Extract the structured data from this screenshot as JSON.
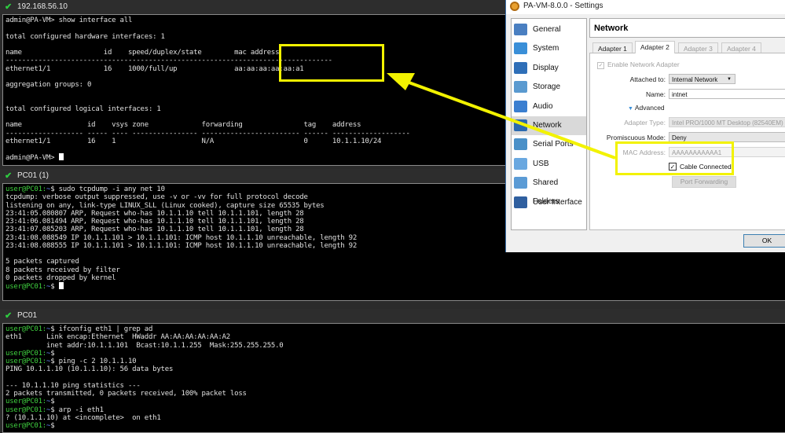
{
  "term1": {
    "tab_title": "192.168.56.10",
    "lines": [
      "admin@PA-VM> show interface all",
      "",
      "total configured hardware interfaces: 1",
      "",
      "name                    id    speed/duplex/state        mac address",
      "--------------------------------------------------------------------------------",
      "ethernet1/1             16    1000/full/up              aa:aa:aa:aa:aa:a1",
      "",
      "aggregation groups: 0",
      "",
      "",
      "total configured logical interfaces: 1",
      "",
      "name                id    vsys zone             forwarding               tag    address",
      "------------------- ----- ---- ---------------- ------------------------ ------ -------------------",
      "ethernet1/1         16    1                     N/A                      0      10.1.1.10/24",
      "",
      "admin@PA-VM> "
    ]
  },
  "term2": {
    "tab_title": "PC01 (1)",
    "prompt_user": "user@PC01:",
    "prompt_tail": "~",
    "prompt_sign": "$ ",
    "lines": [
      {
        "p": true,
        "t": "sudo tcpdump -i any net 10"
      },
      {
        "t": "tcpdump: verbose output suppressed, use -v or -vv for full protocol decode"
      },
      {
        "t": "listening on any, link-type LINUX_SLL (Linux cooked), capture size 65535 bytes"
      },
      {
        "t": "23:41:05.080807 ARP, Request who-has 10.1.1.10 tell 10.1.1.101, length 28"
      },
      {
        "t": "23:41:06.081494 ARP, Request who-has 10.1.1.10 tell 10.1.1.101, length 28"
      },
      {
        "t": "23:41:07.085203 ARP, Request who-has 10.1.1.10 tell 10.1.1.101, length 28"
      },
      {
        "t": "23:41:08.088549 IP 10.1.1.101 > 10.1.1.101: ICMP host 10.1.1.10 unreachable, length 92"
      },
      {
        "t": "23:41:08.088555 IP 10.1.1.101 > 10.1.1.101: ICMP host 10.1.1.10 unreachable, length 92"
      },
      {
        "t": ""
      },
      {
        "t": "5 packets captured"
      },
      {
        "t": "8 packets received by filter"
      },
      {
        "t": "0 packets dropped by kernel"
      },
      {
        "p": true,
        "t": "",
        "cursor": true
      }
    ]
  },
  "term3": {
    "tab_title": "PC01",
    "lines": [
      {
        "p": true,
        "t": "ifconfig eth1 | grep ad"
      },
      {
        "t": "eth1      Link encap:Ethernet  HWaddr AA:AA:AA:AA:AA:A2"
      },
      {
        "t": "          inet addr:10.1.1.101  Bcast:10.1.1.255  Mask:255.255.255.0"
      },
      {
        "p": true,
        "t": ""
      },
      {
        "p": true,
        "t": "ping -c 2 10.1.1.10"
      },
      {
        "t": "PING 10.1.1.10 (10.1.1.10): 56 data bytes"
      },
      {
        "t": ""
      },
      {
        "t": "--- 10.1.1.10 ping statistics ---"
      },
      {
        "t": "2 packets transmitted, 0 packets received, 100% packet loss"
      },
      {
        "p": true,
        "t": ""
      },
      {
        "p": true,
        "t": "arp -i eth1"
      },
      {
        "t": "? (10.1.1.10) at <incomplete>  on eth1"
      },
      {
        "p": true,
        "t": ""
      }
    ]
  },
  "settings": {
    "title": "PA-VM-8.0.0 - Settings",
    "sidebar": [
      {
        "label": "General",
        "color": "#4a7fc1"
      },
      {
        "label": "System",
        "color": "#3a8fd8"
      },
      {
        "label": "Display",
        "color": "#2f6fb8"
      },
      {
        "label": "Storage",
        "color": "#5a9ad0"
      },
      {
        "label": "Audio",
        "color": "#3b7fd0"
      },
      {
        "label": "Network",
        "color": "#2a6ab0",
        "selected": true
      },
      {
        "label": "Serial Ports",
        "color": "#4a90c8"
      },
      {
        "label": "USB",
        "color": "#6aa8e0"
      },
      {
        "label": "Shared Folders",
        "color": "#5b9bd5"
      },
      {
        "label": "User Interface",
        "color": "#2f5f9f"
      }
    ],
    "section_title": "Network",
    "tabs": [
      "Adapter 1",
      "Adapter 2",
      "Adapter 3",
      "Adapter 4"
    ],
    "enable_adapter": "Enable Network Adapter",
    "attached_label": "Attached to:",
    "attached_value": "Internal Network",
    "name_label": "Name:",
    "name_value": "intnet",
    "advanced": "Advanced",
    "adapter_type_label": "Adapter Type:",
    "adapter_type_value": "Intel PRO/1000 MT Desktop (82540EM)",
    "promisc_label": "Promiscuous Mode:",
    "promisc_value": "Deny",
    "mac_label": "MAC Address:",
    "mac_value": "AAAAAAAAAAA1",
    "cable_label": "Cable Connected",
    "port_forwarding": "Port Forwarding",
    "ok": "OK"
  },
  "annotation_color": "#f2f200"
}
